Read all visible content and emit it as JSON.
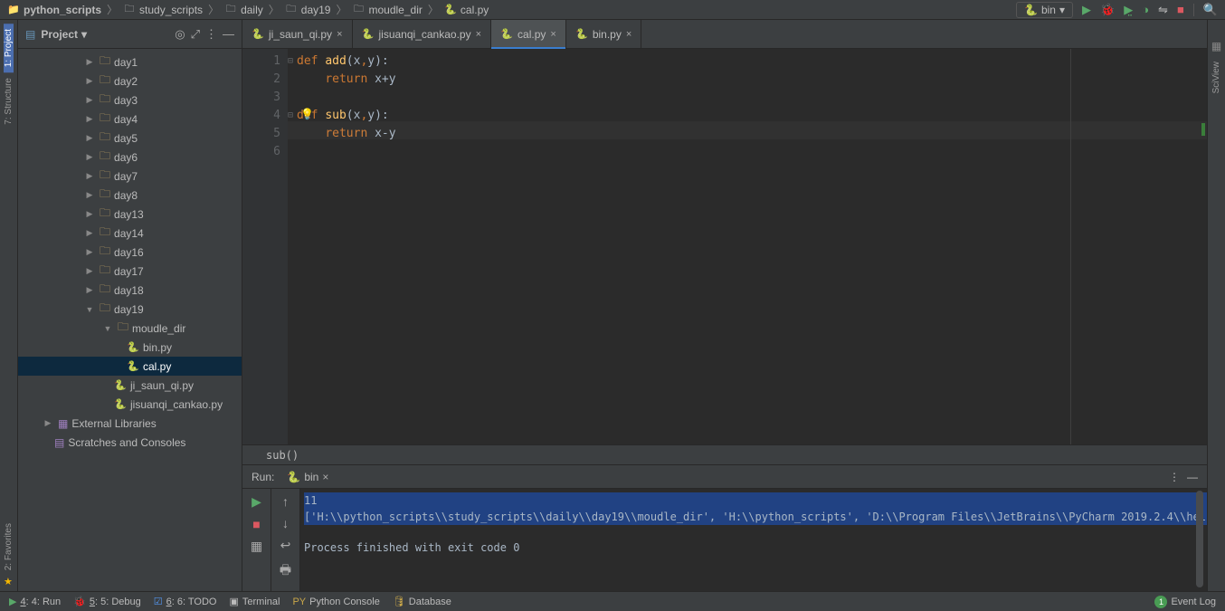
{
  "breadcrumb": [
    {
      "icon": "folder",
      "label": "python_scripts",
      "bold": true
    },
    {
      "icon": "dir",
      "label": "study_scripts"
    },
    {
      "icon": "dir",
      "label": "daily"
    },
    {
      "icon": "dir",
      "label": "day19"
    },
    {
      "icon": "dir",
      "label": "moudle_dir"
    },
    {
      "icon": "python",
      "label": "cal.py"
    }
  ],
  "run_config": "bin",
  "sidebar": {
    "title": "Project",
    "items": [
      {
        "label": "day1",
        "type": "dir",
        "indent": 72,
        "arrow": "▶"
      },
      {
        "label": "day2",
        "type": "dir",
        "indent": 72,
        "arrow": "▶"
      },
      {
        "label": "day3",
        "type": "dir",
        "indent": 72,
        "arrow": "▶"
      },
      {
        "label": "day4",
        "type": "dir",
        "indent": 72,
        "arrow": "▶"
      },
      {
        "label": "day5",
        "type": "dir",
        "indent": 72,
        "arrow": "▶"
      },
      {
        "label": "day6",
        "type": "dir",
        "indent": 72,
        "arrow": "▶"
      },
      {
        "label": "day7",
        "type": "dir",
        "indent": 72,
        "arrow": "▶"
      },
      {
        "label": "day8",
        "type": "dir",
        "indent": 72,
        "arrow": "▶"
      },
      {
        "label": "day13",
        "type": "dir",
        "indent": 72,
        "arrow": "▶"
      },
      {
        "label": "day14",
        "type": "dir",
        "indent": 72,
        "arrow": "▶"
      },
      {
        "label": "day16",
        "type": "dir",
        "indent": 72,
        "arrow": "▶"
      },
      {
        "label": "day17",
        "type": "dir",
        "indent": 72,
        "arrow": "▶"
      },
      {
        "label": "day18",
        "type": "dir",
        "indent": 72,
        "arrow": "▶"
      },
      {
        "label": "day19",
        "type": "dir",
        "indent": 72,
        "arrow": "▼"
      },
      {
        "label": "moudle_dir",
        "type": "dir",
        "indent": 92,
        "arrow": "▼"
      },
      {
        "label": "bin.py",
        "type": "py",
        "indent": 120
      },
      {
        "label": "cal.py",
        "type": "py",
        "indent": 120,
        "selected": true
      },
      {
        "label": "ji_saun_qi.py",
        "type": "py",
        "indent": 106
      },
      {
        "label": "jisuanqi_cankao.py",
        "type": "py",
        "indent": 106
      },
      {
        "label": "External Libraries",
        "type": "lib",
        "indent": 26,
        "arrow": "▶"
      },
      {
        "label": "Scratches and Consoles",
        "type": "scratch",
        "indent": 40
      }
    ]
  },
  "tabs": [
    {
      "label": "ji_saun_qi.py",
      "active": false
    },
    {
      "label": "jisuanqi_cankao.py",
      "active": false
    },
    {
      "label": "cal.py",
      "active": true
    },
    {
      "label": "bin.py",
      "active": false
    }
  ],
  "code": {
    "lines": [
      "1",
      "2",
      "3",
      "4",
      "5",
      "6"
    ],
    "text": "def add(x,y):\n    return x+y\n\ndef sub(x,y):\n    return x-y\n"
  },
  "crumb_status": "sub()",
  "run": {
    "title": "Run:",
    "tab": "bin",
    "output": {
      "l1": "11",
      "l2": "['H:\\\\python_scripts\\\\study_scripts\\\\daily\\\\day19\\\\moudle_dir', 'H:\\\\python_scripts', 'D:\\\\Program Files\\\\JetBrains\\\\PyCharm 2019.2.4\\\\helpers\\\\pycharm_display', 'E:\\\\python_ide\\\\",
      "exit": "Process finished with exit code 0"
    }
  },
  "left_gutter": {
    "project": "1: Project",
    "structure": "7: Structure",
    "favorites": "2: Favorites"
  },
  "right_gutter": {
    "sciview": "SciView"
  },
  "bottom": {
    "run": "4: Run",
    "debug": "5: Debug",
    "todo": "6: TODO",
    "terminal": "Terminal",
    "pyconsole": "Python Console",
    "database": "Database",
    "eventlog": "Event Log"
  }
}
